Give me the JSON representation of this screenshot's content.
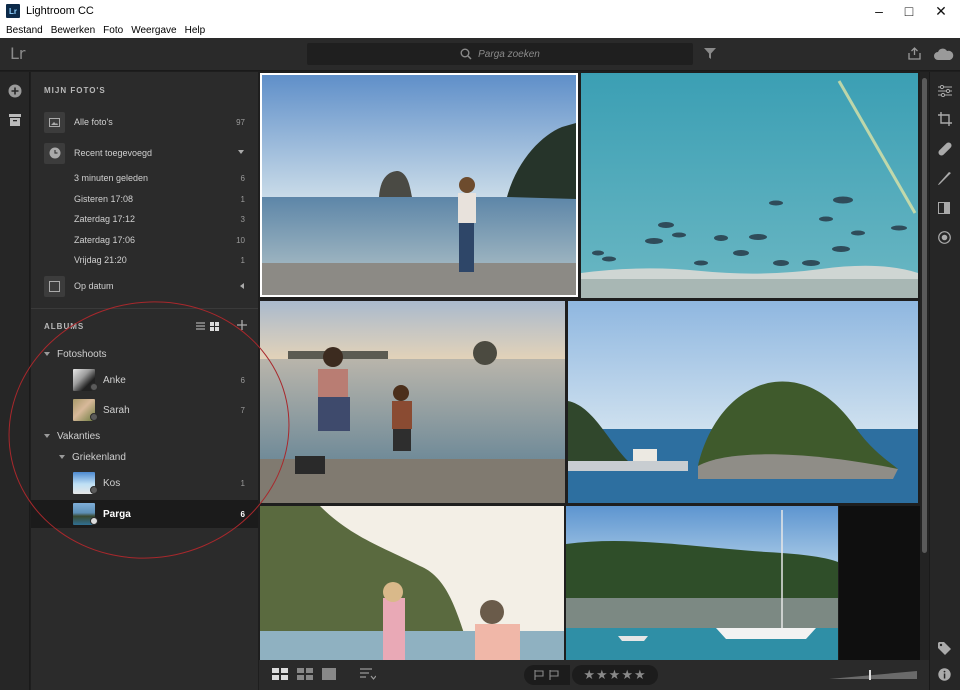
{
  "window": {
    "app_name": "Lightroom CC",
    "logo_text": "Lr"
  },
  "menu": [
    "Bestand",
    "Bewerken",
    "Foto",
    "Weergave",
    "Help"
  ],
  "topbar": {
    "brand": "Lr",
    "search_placeholder": "Parga zoeken"
  },
  "sidebar": {
    "my_photos_title": "MIJN FOTO'S",
    "all_photos": {
      "label": "Alle foto's",
      "count": "97"
    },
    "recent": {
      "label": "Recent toegevoegd"
    },
    "recent_items": [
      {
        "label": "3 minuten geleden",
        "count": "6"
      },
      {
        "label": "Gisteren 17:08",
        "count": "1"
      },
      {
        "label": "Zaterdag 17:12",
        "count": "3"
      },
      {
        "label": "Zaterdag 17:06",
        "count": "10"
      },
      {
        "label": "Vrijdag 21:20",
        "count": "1"
      }
    ],
    "by_date": {
      "label": "Op datum"
    },
    "albums_title": "ALBUMS",
    "groups": {
      "fotoshoots": "Fotoshoots",
      "vakanties": "Vakanties",
      "griekenland": "Griekenland"
    },
    "albums": {
      "anke": {
        "label": "Anke",
        "count": "6"
      },
      "sarah": {
        "label": "Sarah",
        "count": "7"
      },
      "kos": {
        "label": "Kos",
        "count": "1"
      },
      "parga": {
        "label": "Parga",
        "count": "6"
      }
    }
  },
  "colors": {
    "accent_annotation": "#a8282c",
    "selected_bg": "#1b1b1b",
    "panel_bg": "#2b2b2b"
  },
  "icons": [
    "add-icon",
    "library-icon",
    "filter-icon",
    "share-icon",
    "cloud-icon",
    "edit-sliders-icon",
    "crop-icon",
    "healing-icon",
    "brush-icon",
    "linear-gradient-icon",
    "radial-gradient-icon",
    "keyword-icon",
    "info-icon"
  ]
}
